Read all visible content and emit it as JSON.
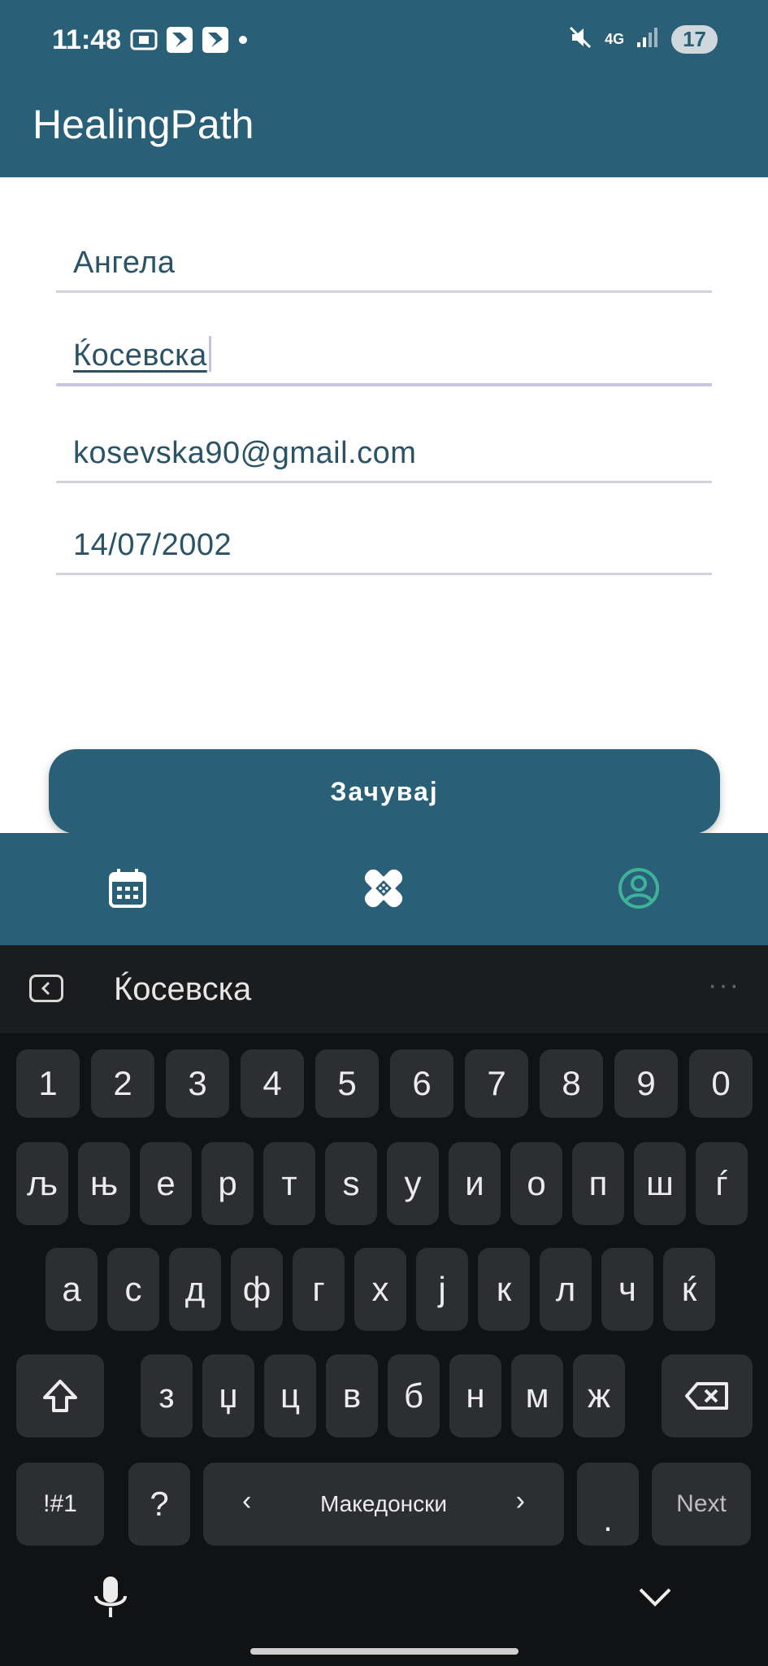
{
  "status_bar": {
    "time": "11:48",
    "network": "4G",
    "battery": "17"
  },
  "app": {
    "title": "HealingPath"
  },
  "form": {
    "first_name": "Ангела",
    "last_name": "Ќосевска",
    "email": "kosevska90@gmail.com",
    "birth_date": "14/07/2002",
    "save_label": "Зачувај"
  },
  "bottom_nav": {
    "items": [
      "calendar-icon",
      "bandage-icon",
      "profile-icon"
    ],
    "active_color": "#3fb39a"
  },
  "keyboard": {
    "suggestion": "Ќосевска",
    "numbers": [
      "1",
      "2",
      "3",
      "4",
      "5",
      "6",
      "7",
      "8",
      "9",
      "0"
    ],
    "row1": [
      "љ",
      "њ",
      "е",
      "р",
      "т",
      "ѕ",
      "у",
      "и",
      "о",
      "п",
      "ш",
      "ѓ"
    ],
    "row2": [
      "а",
      "с",
      "д",
      "ф",
      "г",
      "х",
      "ј",
      "к",
      "л",
      "ч",
      "ќ"
    ],
    "row3": [
      "з",
      "џ",
      "ц",
      "в",
      "б",
      "н",
      "м",
      "ж"
    ],
    "symbols_label": "!#1",
    "question_label": "?",
    "language_label": "Македонски",
    "period_label": ".",
    "next_label": "Next"
  },
  "colors": {
    "primary": "#2a6077",
    "text": "#2b5366",
    "keyboard_bg": "#111214",
    "key_bg": "#2d2e31"
  }
}
